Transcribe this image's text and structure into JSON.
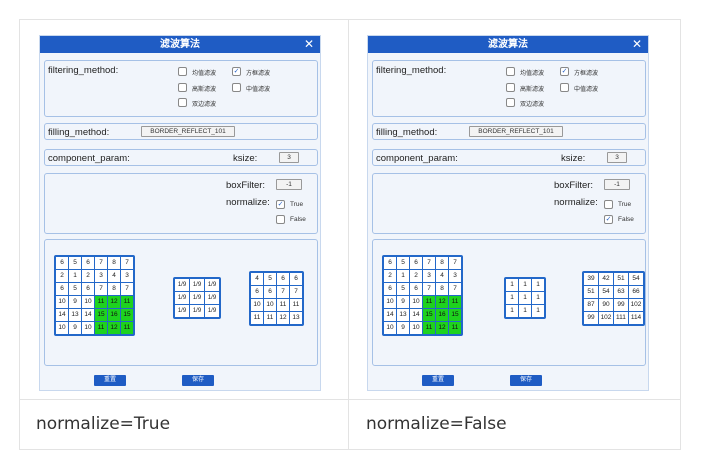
{
  "left": {
    "dialog": {
      "title": "滤波算法",
      "close": "✕",
      "filtering_method_label": "filtering_method:",
      "options": [
        {
          "label": "均值滤波",
          "checked": false
        },
        {
          "label": "方框滤波",
          "checked": true
        },
        {
          "label": "高斯滤波",
          "checked": false
        },
        {
          "label": "中值滤波",
          "checked": false
        },
        {
          "label": "双边滤波",
          "checked": false
        }
      ],
      "filling_method_label": "filling_method:",
      "filling_method_value": "BORDER_REFLECT_101",
      "component_param_label": "component_param:",
      "ksize_label": "ksize:",
      "ksize_value": "3",
      "boxfilter_label": "boxFilter:",
      "boxfilter_value": "-1",
      "normalize_label": "normalize:",
      "true_label": "True",
      "false_label": "False",
      "true_checked": true,
      "false_checked": false,
      "reset_button": "重置",
      "save_button": "保存"
    },
    "caption": "normalize=True",
    "input_matrix": [
      [
        "6",
        "5",
        "6",
        "7",
        "8",
        "7"
      ],
      [
        "2",
        "1",
        "2",
        "3",
        "4",
        "3"
      ],
      [
        "6",
        "5",
        "6",
        "7",
        "8",
        "7"
      ],
      [
        "10",
        "9",
        "10",
        "11",
        "12",
        "11"
      ],
      [
        "14",
        "13",
        "14",
        "15",
        "16",
        "15"
      ],
      [
        "10",
        "9",
        "10",
        "11",
        "12",
        "11"
      ]
    ],
    "kernel": [
      [
        "1/9",
        "1/9",
        "1/9"
      ],
      [
        "1/9",
        "1/9",
        "1/9"
      ],
      [
        "1/9",
        "1/9",
        "1/9"
      ]
    ],
    "output_matrix": [
      [
        "4",
        "5",
        "6",
        "6"
      ],
      [
        "6",
        "6",
        "7",
        "7"
      ],
      [
        "10",
        "10",
        "11",
        "11"
      ],
      [
        "11",
        "11",
        "12",
        "13"
      ]
    ]
  },
  "right": {
    "dialog": {
      "title": "滤波算法",
      "close": "✕",
      "filtering_method_label": "filtering_method:",
      "options": [
        {
          "label": "均值滤波",
          "checked": false
        },
        {
          "label": "方框滤波",
          "checked": true
        },
        {
          "label": "高斯滤波",
          "checked": false
        },
        {
          "label": "中值滤波",
          "checked": false
        },
        {
          "label": "双边滤波",
          "checked": false
        }
      ],
      "filling_method_label": "filling_method:",
      "filling_method_value": "BORDER_REFLECT_101",
      "component_param_label": "component_param:",
      "ksize_label": "ksize:",
      "ksize_value": "3",
      "boxfilter_label": "boxFilter:",
      "boxfilter_value": "-1",
      "normalize_label": "normalize:",
      "true_label": "True",
      "false_label": "False",
      "true_checked": false,
      "false_checked": true,
      "reset_button": "重置",
      "save_button": "保存"
    },
    "caption": "normalize=False",
    "input_matrix": [
      [
        "6",
        "5",
        "6",
        "7",
        "8",
        "7"
      ],
      [
        "2",
        "1",
        "2",
        "3",
        "4",
        "3"
      ],
      [
        "6",
        "5",
        "6",
        "7",
        "8",
        "7"
      ],
      [
        "10",
        "9",
        "10",
        "11",
        "12",
        "11"
      ],
      [
        "14",
        "13",
        "14",
        "15",
        "16",
        "15"
      ],
      [
        "10",
        "9",
        "10",
        "11",
        "12",
        "11"
      ]
    ],
    "kernel": [
      [
        "1",
        "1",
        "1"
      ],
      [
        "1",
        "1",
        "1"
      ],
      [
        "1",
        "1",
        "1"
      ]
    ],
    "output_matrix": [
      [
        "39",
        "42",
        "51",
        "54"
      ],
      [
        "51",
        "54",
        "63",
        "66"
      ],
      [
        "87",
        "90",
        "99",
        "102"
      ],
      [
        "99",
        "102",
        "111",
        "114"
      ]
    ]
  },
  "highlight_color": "#1ed21e",
  "accent_color": "#1f5cc4"
}
